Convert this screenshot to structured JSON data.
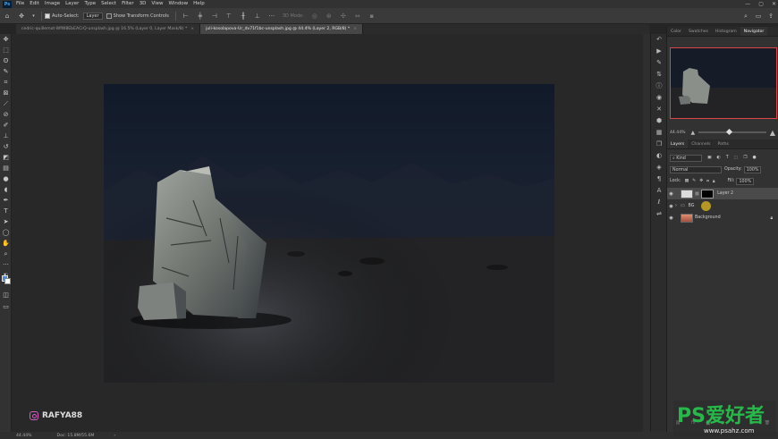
{
  "menubar": {
    "logo": "Ps",
    "items": [
      "File",
      "Edit",
      "Image",
      "Layer",
      "Type",
      "Select",
      "Filter",
      "3D",
      "View",
      "Window",
      "Help"
    ],
    "window_controls": [
      "—",
      "▢",
      "✕"
    ]
  },
  "optionsbar": {
    "auto_select_label": "Auto-Select:",
    "auto_select_target": "Layer",
    "show_transform_label": "Show Transform Controls",
    "mode_3d_label": "3D Mode:"
  },
  "tabs": [
    {
      "label": "cedric-quillemot-WfW8EbEACrQ-unsplash.jpg @ 16.5% (Layer 0, Layer Mask/8) *",
      "close": "×"
    },
    {
      "label": "juli-kosolapova-Ur_dv71f1bc-unsplash.jpg @ 44.4% (Layer 2, RGB/8) *",
      "close": "×"
    }
  ],
  "statusbar": {
    "zoom": "44.44%",
    "doc_info": "Doc: 15.8M/55.6M"
  },
  "watermark": {
    "handle": "RAFYA88",
    "site_logo_text": "PS爱好者",
    "site_url": "www.psahz.com"
  },
  "panels": {
    "top_tabs": [
      "Color",
      "Swatches",
      "Histogram",
      "Navigator"
    ],
    "navigator_zoom": "44.44%",
    "navigator_zoom_fraction": 0.45,
    "layers_tabs": [
      "Layers",
      "Channels",
      "Paths"
    ],
    "filter_kind": "Kind",
    "blend_mode": "Normal",
    "opacity_label": "Opacity:",
    "opacity_value": "100%",
    "lock_label": "Lock:",
    "fill_label": "Fill:",
    "fill_value": "100%",
    "layers": [
      {
        "name": "Layer 2",
        "selected": true
      },
      {
        "name": "BG",
        "selected": false
      },
      {
        "name": "Background",
        "selected": false
      }
    ]
  }
}
